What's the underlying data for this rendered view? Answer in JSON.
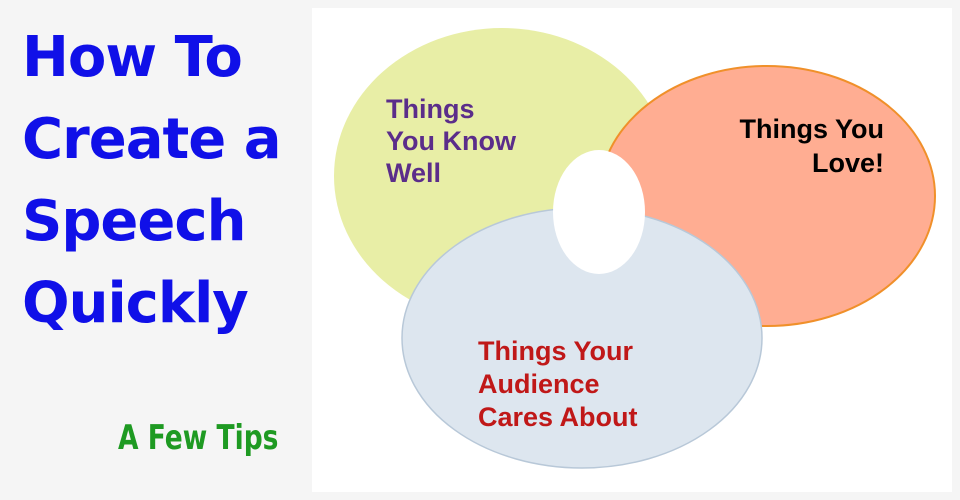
{
  "title": {
    "lines": [
      "How To",
      "Create a",
      "Speech",
      "Quickly"
    ]
  },
  "subtitle": "A Few Tips",
  "venn": {
    "circles": [
      {
        "id": "know",
        "lines": [
          "Things",
          "You Know",
          "Well"
        ],
        "fill": "#e8eea6",
        "stroke": "#c8cf86",
        "text_color": "#5b2d8a"
      },
      {
        "id": "love",
        "lines": [
          "Things You",
          "Love!"
        ],
        "fill": "#ffad92",
        "stroke": "#f0902a",
        "text_color": "#000000"
      },
      {
        "id": "audience",
        "lines": [
          "Things Your",
          "Audience",
          "Cares About"
        ],
        "fill": "#dde6ef",
        "stroke": "#b8c8d8",
        "text_color": "#c01818"
      }
    ],
    "center_fill": "#ffffff"
  },
  "colors": {
    "title": "#1010e8",
    "subtitle": "#1e9a22"
  }
}
